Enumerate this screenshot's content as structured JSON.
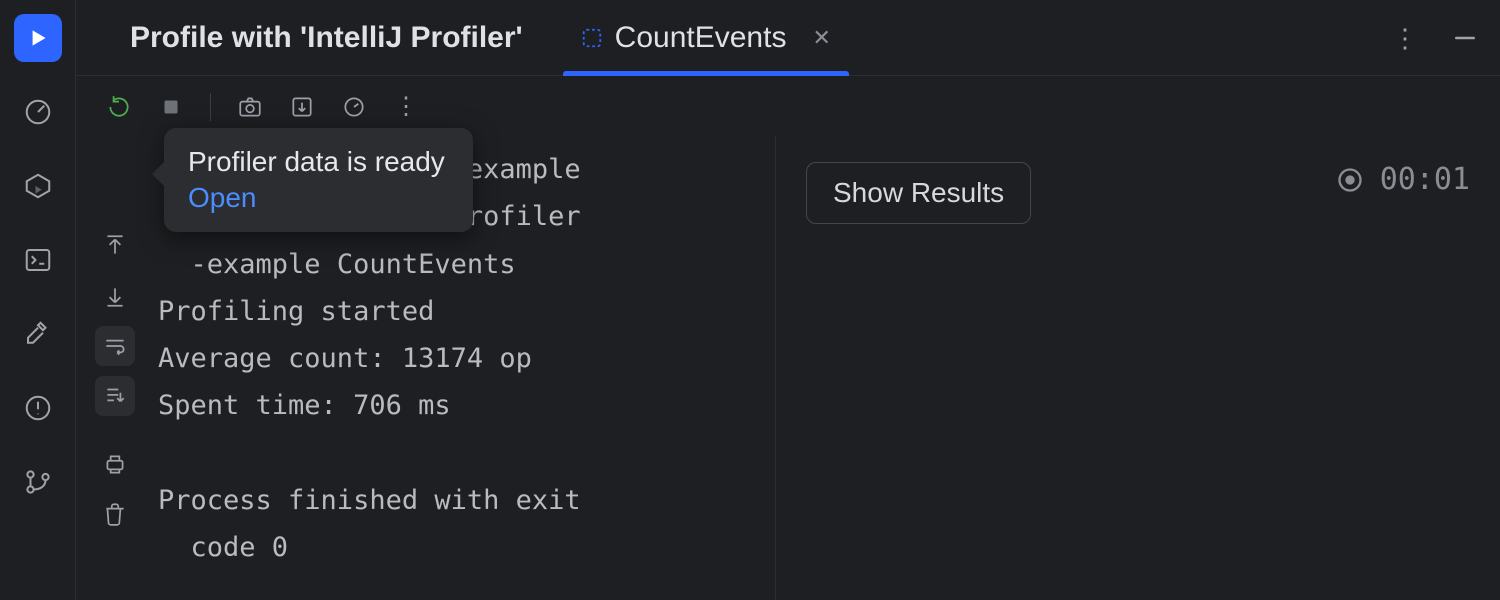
{
  "header": {
    "title": "Profile with 'IntelliJ Profiler'",
    "active_tab_label": "CountEvents"
  },
  "notification": {
    "title": "Profiler data is ready",
    "action": "Open"
  },
  "console": {
    "lines": [
      "            ofiler-example",
      "  /out/production/profiler",
      "  -example CountEvents",
      "Profiling started",
      "Average count: 13174 op",
      "Spent time: 706 ms",
      "",
      "Process finished with exit",
      "  code 0"
    ]
  },
  "right": {
    "show_results_label": "Show Results",
    "timer": "00:01"
  }
}
